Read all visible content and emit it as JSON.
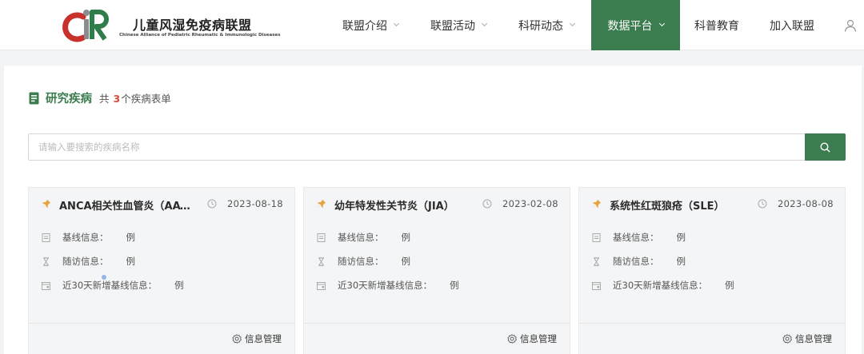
{
  "header": {
    "brand_cn": "儿童风湿免疫病联盟",
    "brand_en": "Chinese Alliance of Pediatric Rheumatic & Immunologic Diseases",
    "nav": [
      {
        "label": "联盟介绍",
        "has_dropdown": true,
        "active": false
      },
      {
        "label": "联盟活动",
        "has_dropdown": true,
        "active": false
      },
      {
        "label": "科研动态",
        "has_dropdown": true,
        "active": false
      },
      {
        "label": "数据平台",
        "has_dropdown": true,
        "active": true
      },
      {
        "label": "科普教育",
        "has_dropdown": false,
        "active": false
      },
      {
        "label": "加入联盟",
        "has_dropdown": false,
        "active": false
      }
    ],
    "user_icon": "user-icon"
  },
  "section": {
    "title": "研究疾病",
    "count_prefix": "共",
    "count": "3",
    "count_suffix": "个疾病表单"
  },
  "search": {
    "placeholder": "请输入要搜索的疾病名称",
    "value": "",
    "button_icon": "search-icon"
  },
  "cards": [
    {
      "title": "ANCA相关性血管炎（AAV）",
      "date": "2023-08-18",
      "rows": [
        {
          "label": "基线信息：",
          "value": "",
          "unit": "例"
        },
        {
          "label": "随访信息：",
          "value": "",
          "unit": "例"
        },
        {
          "label": "近30天新增基线信息：",
          "value": "",
          "unit": "例"
        }
      ],
      "manage_label": "信息管理"
    },
    {
      "title": "幼年特发性关节炎（JIA）",
      "date": "2023-02-08",
      "rows": [
        {
          "label": "基线信息：",
          "value": "",
          "unit": "例"
        },
        {
          "label": "随访信息：",
          "value": "",
          "unit": "例"
        },
        {
          "label": "近30天新增基线信息：",
          "value": "",
          "unit": "例"
        }
      ],
      "manage_label": "信息管理"
    },
    {
      "title": "系统性红斑狼疮（SLE）",
      "date": "2023-08-08",
      "rows": [
        {
          "label": "基线信息：",
          "value": "",
          "unit": "例"
        },
        {
          "label": "随访信息：",
          "value": "",
          "unit": "例"
        },
        {
          "label": "近30天新增基线信息：",
          "value": "",
          "unit": "例"
        }
      ],
      "manage_label": "信息管理"
    }
  ],
  "colors": {
    "accent": "#3b7d4e",
    "count_highlight": "#d9473d",
    "logo_red": "#c8312b",
    "logo_grey": "#8a8d8f",
    "logo_green": "#2e7d4a",
    "pin": "#e8a33d"
  }
}
